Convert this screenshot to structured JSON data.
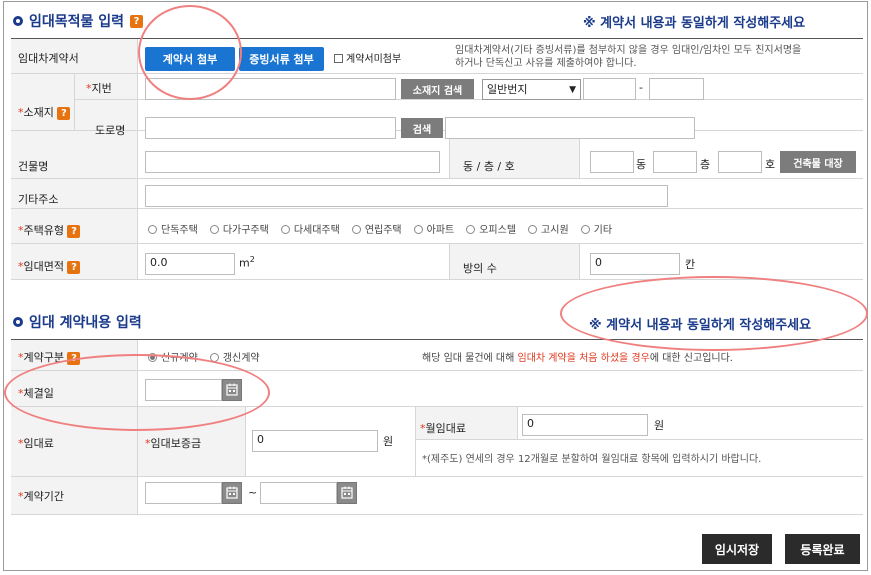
{
  "section1": {
    "title": "임대목적물 입력",
    "help": "?",
    "notice": "※ 계약서 내용과 동일하게 작성해주세요",
    "contract_row": {
      "label": "임대차계약서",
      "attach_contract": "계약서 첨부",
      "attach_evidence": "증빙서류 첨부",
      "checkbox_label": "계약서미첨부",
      "note_line1": "임대차계약서(기타 증빙서류)를 첨부하지 않을 경우 임대인/임차인 모두 친지서명을",
      "note_line2": "하거나 단독신고 사유를 제출하여야 합니다."
    },
    "location": {
      "label": "소재지",
      "jibun_label": "지번",
      "road_label": "도로명",
      "search_btn": "소재지 검색",
      "lot_select": "일반번지",
      "dash": "-",
      "road_search_btn": "검색"
    },
    "building": {
      "label": "건물명",
      "dong_label": "동 / 층 / 호",
      "dong_unit": "동",
      "floor_unit": "층",
      "ho_unit": "호",
      "ledger_btn": "건축물 대장"
    },
    "other_address": {
      "label": "기타주소"
    },
    "housing_type": {
      "label": "주택유형",
      "options": [
        "단독주택",
        "다가구주택",
        "다세대주택",
        "연립주택",
        "아파트",
        "오피스텔",
        "고시원",
        "기타"
      ]
    },
    "area": {
      "label": "임대면적",
      "value": "0.0",
      "unit": "m",
      "unit_sup": "2",
      "rooms_label": "방의 수",
      "rooms_value": "0",
      "rooms_unit": "칸"
    }
  },
  "section2": {
    "title": "임대 계약내용 입력",
    "notice": "※ 계약서 내용과 동일하게 작성해주세요",
    "contract_type": {
      "label": "계약구분",
      "new": "신규계약",
      "renew": "갱신계약",
      "note_pre": "해당 임대 물건에 대해 ",
      "note_red": "임대차 계약을 처음 하셨을 경우",
      "note_post": "에 대한 신고입니다."
    },
    "signing_date": {
      "label": "체결일"
    },
    "rent": {
      "label": "임대료",
      "deposit_label": "임대보증금",
      "deposit_value": "0",
      "deposit_unit": "원",
      "monthly_label": "월임대료",
      "monthly_value": "0",
      "monthly_unit": "원",
      "monthly_note": "*(제주도) 연세의 경우 12개월로 분할하여 월임대료 항목에 입력하시기 바랍니다."
    },
    "period": {
      "label": "계약기간",
      "tilde": "~"
    }
  },
  "actions": {
    "temp_save": "임시저장",
    "complete": "등록완료"
  },
  "colors": {
    "accent": "#1a3a8a",
    "button_blue": "#1a75d2",
    "required": "#e0391f",
    "help": "#e6730f",
    "highlight_ring": "#f08080"
  }
}
